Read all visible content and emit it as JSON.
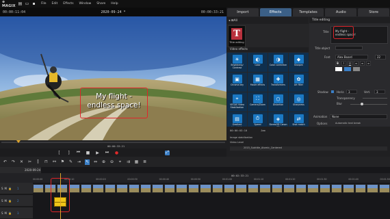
{
  "app": {
    "brand": "⊕ MAGIX"
  },
  "menu": [
    "File",
    "Edit",
    "Effects",
    "Window",
    "Share",
    "Help"
  ],
  "preview": {
    "timecode_left": "00:00:11:04",
    "project": "2020-09-24 *",
    "timecode_right": "00:00:33:21",
    "caption_line1": "My flight -",
    "caption_line2": "endless space!",
    "scrub_time": "00:00:33:21"
  },
  "tabs": [
    "Import",
    "Effects",
    "Templates",
    "Audio",
    "Store"
  ],
  "category": "All",
  "title_tile": "Title editing",
  "video_effects_header": "Video effects",
  "effects": [
    {
      "label": "Brightness/ Contrast",
      "icon": "☀"
    },
    {
      "label": "Color",
      "icon": "◐"
    },
    {
      "label": "Color correction",
      "icon": "◑"
    },
    {
      "label": "Sharpen",
      "icon": "◆"
    },
    {
      "label": "Chroma key",
      "icon": "▣"
    },
    {
      "label": "Movie effects",
      "icon": "▦"
    },
    {
      "label": "Transformers",
      "icon": "✚"
    },
    {
      "label": "Art filter",
      "icon": "✿"
    },
    {
      "label": "VEGAS Video Stabilization",
      "icon": "⌖"
    },
    {
      "label": "Camera/Zoom",
      "icon": "⛶"
    },
    {
      "label": "Distortion",
      "icon": "⬡"
    },
    {
      "label": "Sharpness",
      "icon": "◎"
    },
    {
      "label": "Gradient Unschärfe",
      "icon": "▤"
    },
    {
      "label": "Speed",
      "icon": "⏱"
    },
    {
      "label": "Stereo3D Canon 3D",
      "icon": "◈"
    },
    {
      "label": "Shot match",
      "icon": "⇄"
    }
  ],
  "title_editing": {
    "header": "Title editing",
    "title_label": "Title",
    "title_value_line1": "My flight -",
    "title_value_line2": "endless space!",
    "title_object_label": "Title object",
    "font_label": "Font",
    "font_value": "Alex Board",
    "font_size": "22",
    "shadow_label": "Shadow",
    "horiz_label": "Horiz.",
    "horiz_value": "3",
    "vert_label": "Vert.",
    "vert_value": "3",
    "transparency_label": "Transparency",
    "blur_label": "Blur",
    "animation_label": "Animation",
    "animation_value": "None",
    "options_label": "Options",
    "option1": "Automatic text break",
    "option2": "Adjust font size to fit title field"
  },
  "mini_timeline": {
    "time": "00:00:03:10",
    "mode": "Jam",
    "label1": "Image stabilization",
    "label2": "Video Level",
    "label3": "2015_Subtitle_Atomic_Centered"
  },
  "timeline": {
    "project_tab": "2020-09-24",
    "ruler_center": "00:02:33:21",
    "ruler_marks": [
      "00:00:00",
      "00:00:10",
      "00:00:20",
      "00:00:30",
      "00:00:40",
      "00:00:50",
      "00:01:00",
      "00:01:10",
      "00:01:20",
      "00:01:30",
      "00:01:40",
      "00:01:50"
    ],
    "track_numbers": [
      "1",
      "2",
      "3"
    ]
  },
  "colors": {
    "accent": "#3b5f86",
    "highlight": "#e0242a",
    "tile": "#1b78c3",
    "title_tile": "#b8313d"
  }
}
